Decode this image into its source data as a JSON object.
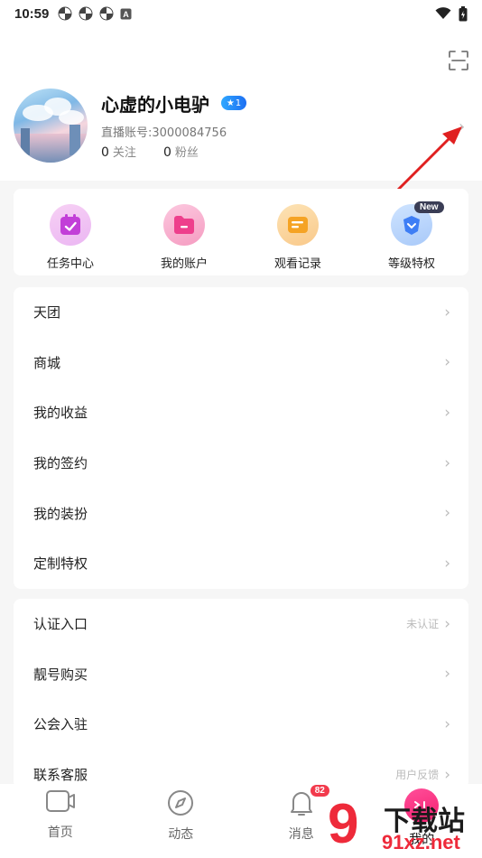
{
  "status_bar": {
    "time": "10:59",
    "notification_icons": [
      "pinwheel-icon",
      "pinwheel-icon",
      "pinwheel-icon",
      "a-square-icon"
    ],
    "right_icons": [
      "wifi-icon",
      "battery-icon"
    ]
  },
  "header": {
    "scan_icon": "scan-icon"
  },
  "profile": {
    "username": "心虚的小电驴",
    "level": "1",
    "account_label": "直播账号:3000084756",
    "following_count": "0",
    "following_label": "关注",
    "fans_count": "0",
    "fans_label": "粉丝"
  },
  "quick_actions": [
    {
      "label": "任务中心",
      "icon": "task-calendar-icon"
    },
    {
      "label": "我的账户",
      "icon": "folder-icon"
    },
    {
      "label": "观看记录",
      "icon": "record-card-icon"
    },
    {
      "label": "等级特权",
      "icon": "level-privilege-icon",
      "badge": "New"
    }
  ],
  "menu_group_1": [
    {
      "label": "天团"
    },
    {
      "label": "商城"
    },
    {
      "label": "我的收益"
    },
    {
      "label": "我的签约"
    },
    {
      "label": "我的装扮"
    },
    {
      "label": "定制特权"
    }
  ],
  "menu_group_2": [
    {
      "label": "认证入口",
      "value": "未认证"
    },
    {
      "label": "靓号购买",
      "value": ""
    },
    {
      "label": "公会入驻",
      "value": ""
    },
    {
      "label": "联系客服",
      "value": "用户反馈"
    }
  ],
  "bottom_nav": [
    {
      "label": "首页",
      "icon": "tv-icon"
    },
    {
      "label": "动态",
      "icon": "compass-icon"
    },
    {
      "label": "消息",
      "icon": "bell-icon",
      "badge": "82"
    },
    {
      "label": "我的",
      "icon": "me-face-icon",
      "active": true
    }
  ],
  "watermark": {
    "line1": "下载站",
    "line2": "91xz.net",
    "logo": "9"
  },
  "colors": {
    "accent": "#f23a4c",
    "badge_blue": "#1d6ff2",
    "arrow": "#e02020"
  }
}
